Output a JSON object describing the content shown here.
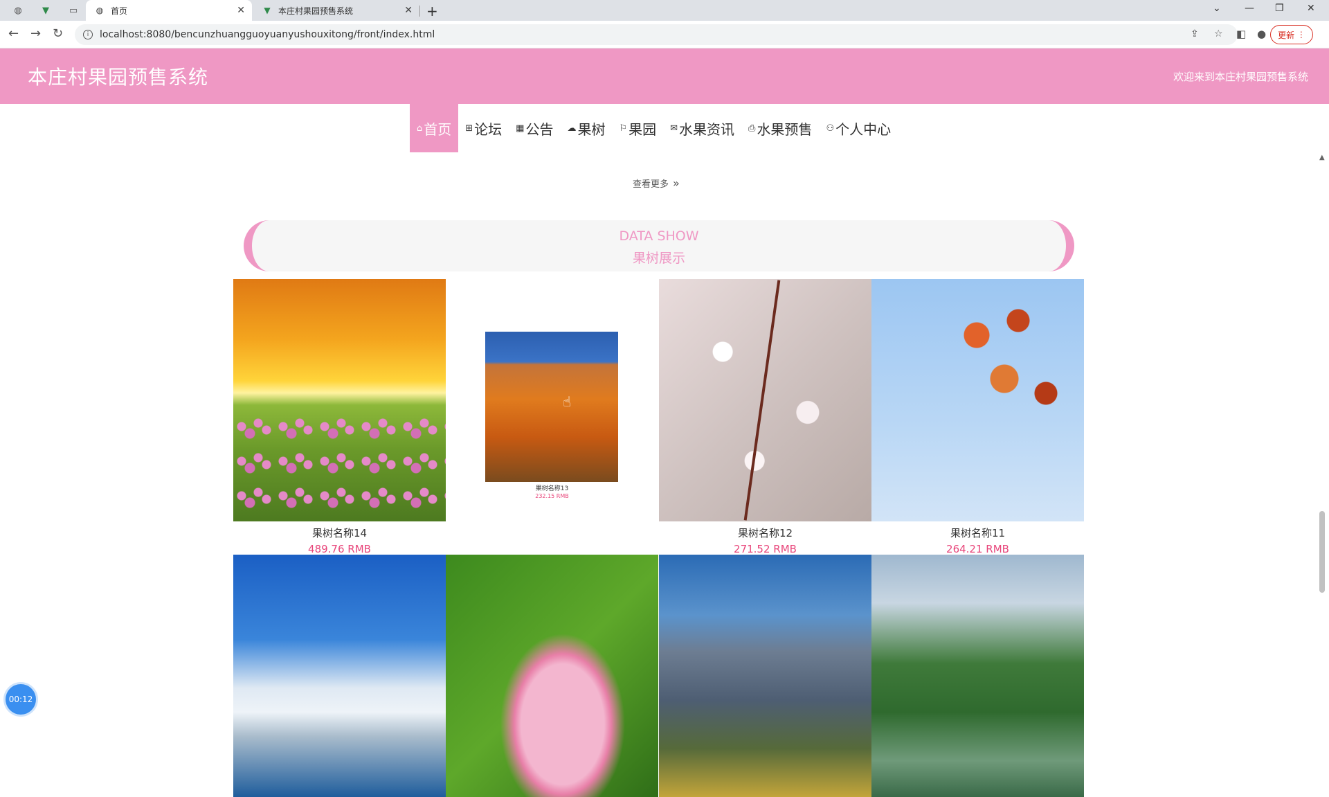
{
  "browser": {
    "tabs": [
      {
        "title": "首页",
        "active": true
      },
      {
        "title": "本庄村果园预售系统",
        "active": false
      }
    ],
    "url": "localhost:8080/bencunzhuangguoyuanyushouxitong/front/index.html",
    "update_label": "更新"
  },
  "site": {
    "title": "本庄村果园预售系统",
    "welcome": "欢迎来到本庄村果园预售系统"
  },
  "menu": [
    {
      "label": "首页",
      "icon": "home-icon",
      "glyph": "⌂"
    },
    {
      "label": "论坛",
      "icon": "forum-icon",
      "glyph": "⊞"
    },
    {
      "label": "公告",
      "icon": "notice-icon",
      "glyph": "▦"
    },
    {
      "label": "果树",
      "icon": "tree-icon",
      "glyph": "☁"
    },
    {
      "label": "果园",
      "icon": "flag-icon",
      "glyph": "⚐"
    },
    {
      "label": "水果资讯",
      "icon": "mail-icon",
      "glyph": "✉"
    },
    {
      "label": "水果预售",
      "icon": "print-icon",
      "glyph": "⎙"
    },
    {
      "label": "个人中心",
      "icon": "user-icon",
      "glyph": "⚇"
    }
  ],
  "more_label": "查看更多",
  "section": {
    "title_en": "DATA SHOW",
    "title_cn": "果树展示"
  },
  "products": [
    {
      "name": "果树名称14",
      "price": "489.76 RMB"
    },
    {
      "name": "果树名称13",
      "price": "232.15 RMB"
    },
    {
      "name": "果树名称12",
      "price": "271.52 RMB"
    },
    {
      "name": "果树名称11",
      "price": "264.21 RMB"
    }
  ],
  "timer": "00:12"
}
